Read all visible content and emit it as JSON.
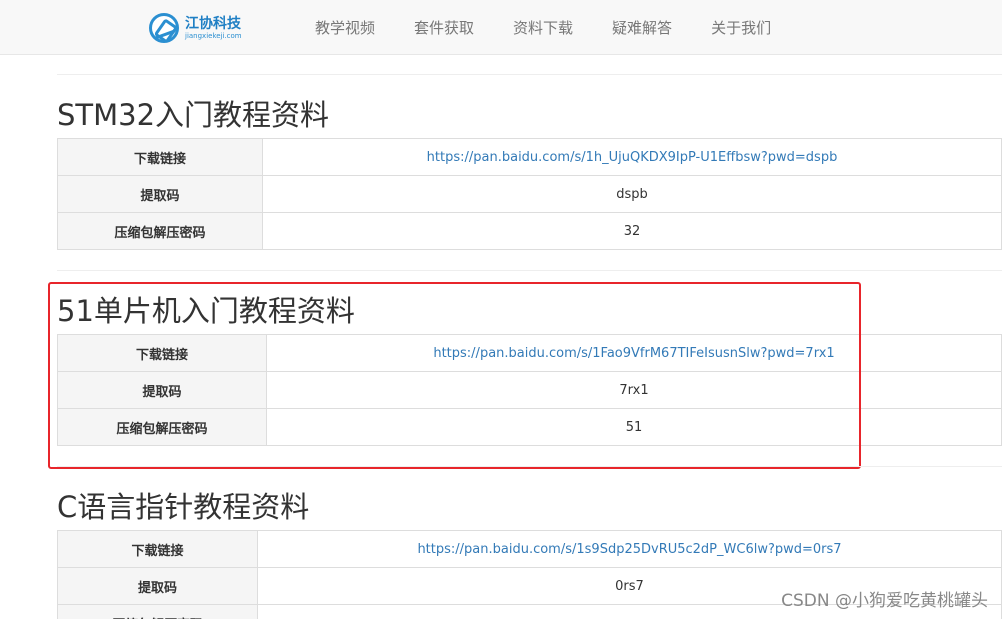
{
  "brand": {
    "name": "江协科技",
    "sub": "jiangxiekeji.com",
    "accent_color": "#2b8fd1"
  },
  "nav": {
    "items": [
      "教学视频",
      "套件获取",
      "资料下载",
      "疑难解答",
      "关于我们"
    ]
  },
  "sections": [
    {
      "title": "STM32入门教程资料",
      "rows": [
        {
          "label": "下载链接",
          "value": "https://pan.baidu.com/s/1h_UjuQKDX9IpP-U1Effbsw?pwd=dspb"
        },
        {
          "label": "提取码",
          "value": "dspb"
        },
        {
          "label": "压缩包解压密码",
          "value": "32"
        }
      ]
    },
    {
      "title": "51单片机入门教程资料",
      "rows": [
        {
          "label": "下载链接",
          "value": "https://pan.baidu.com/s/1Fao9VfrM67TIFeIsusnSlw?pwd=7rx1"
        },
        {
          "label": "提取码",
          "value": "7rx1"
        },
        {
          "label": "压缩包解压密码",
          "value": "51"
        }
      ]
    },
    {
      "title": "C语言指针教程资料",
      "rows": [
        {
          "label": "下载链接",
          "value": "https://pan.baidu.com/s/1s9Sdp25DvRU5c2dP_WC6lw?pwd=0rs7"
        },
        {
          "label": "提取码",
          "value": "0rs7"
        },
        {
          "label": "压缩包解压密码",
          "value": "..."
        }
      ]
    }
  ],
  "highlight_color": "#e8252b",
  "watermark": "CSDN @小狗爱吃黄桃罐头"
}
